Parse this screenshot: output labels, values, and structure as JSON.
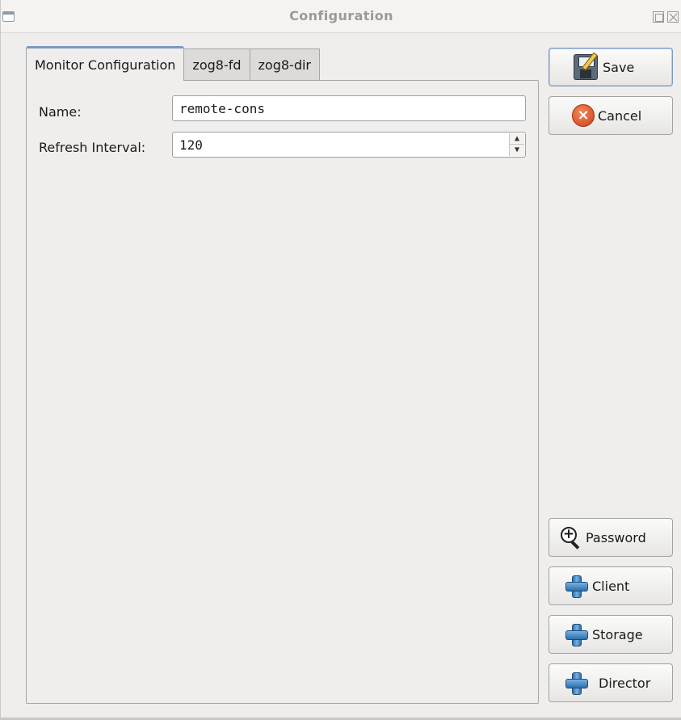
{
  "window": {
    "title": "Configuration"
  },
  "tabs": [
    {
      "label": "Monitor Configuration",
      "active": true
    },
    {
      "label": "zog8-fd",
      "active": false
    },
    {
      "label": "zog8-dir",
      "active": false
    }
  ],
  "form": {
    "name_label": "Name:",
    "name_value": "remote-cons",
    "refresh_label": "Refresh Interval:",
    "refresh_value": "120"
  },
  "buttons": {
    "save": {
      "label": "Save",
      "icon": "save-icon"
    },
    "cancel": {
      "label": "Cancel",
      "icon": "cancel-icon"
    },
    "password": {
      "label": "Password",
      "icon": "zoom-in-icon"
    },
    "client": {
      "label": "Client",
      "icon": "plus-icon"
    },
    "storage": {
      "label": "Storage",
      "icon": "plus-icon"
    },
    "director": {
      "label": "Director",
      "icon": "plus-icon"
    }
  },
  "colors": {
    "background": "#efeeed",
    "active_tab_accent": "#7a98c4",
    "cancel_red": "#cf3d17",
    "plus_blue": "#2f6fa8"
  }
}
